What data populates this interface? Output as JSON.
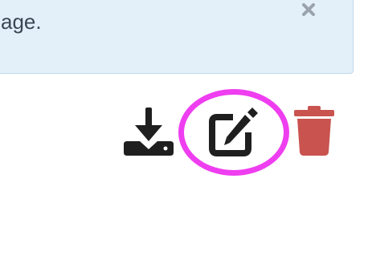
{
  "alert": {
    "message": "age.",
    "close_icon": "times-icon",
    "background_color": "#e4f0f9",
    "text_color": "#3b4654"
  },
  "actions": {
    "download_icon": "download-icon",
    "edit_icon": "edit-icon",
    "delete_icon": "trash-icon",
    "icon_color": "#1f1f1f",
    "delete_color": "#c9534f"
  },
  "annotation": {
    "highlight_color": "#ee3ef0"
  }
}
